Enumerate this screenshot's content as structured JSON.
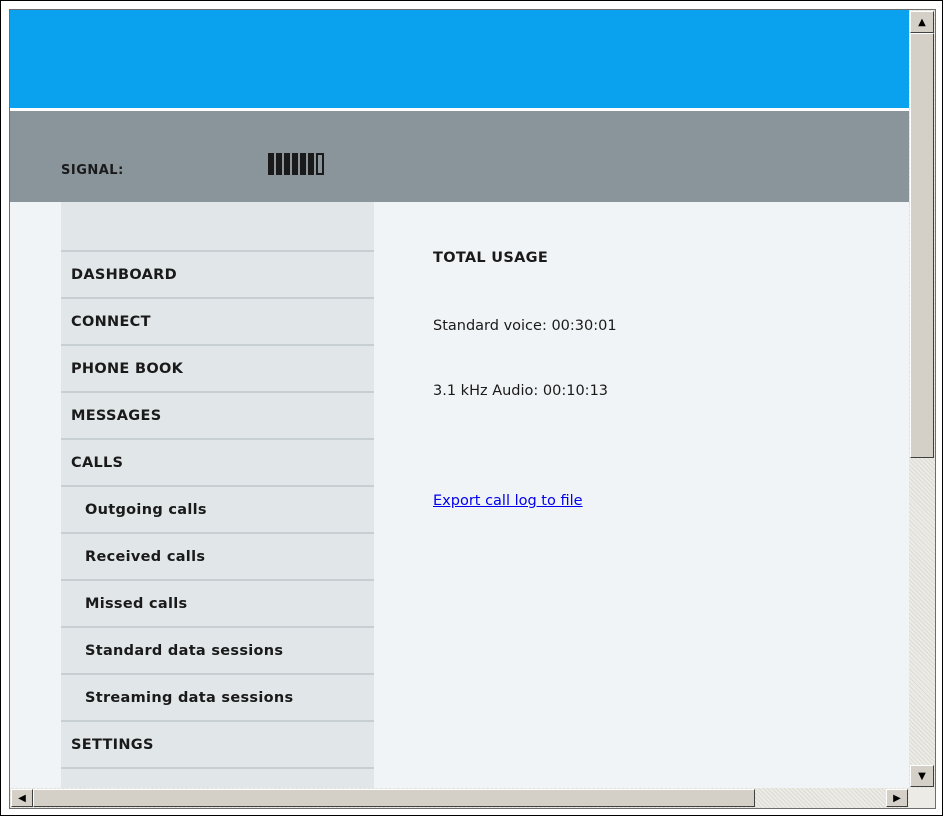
{
  "header": {
    "signal_label": "SIGNAL:",
    "signal_bars_filled": 6,
    "signal_bars_total": 7
  },
  "nav": {
    "items": [
      {
        "label": "DASHBOARD"
      },
      {
        "label": "CONNECT"
      },
      {
        "label": "PHONE BOOK"
      },
      {
        "label": "MESSAGES"
      },
      {
        "label": "CALLS"
      },
      {
        "label": "Outgoing calls"
      },
      {
        "label": "Received calls"
      },
      {
        "label": "Missed calls"
      },
      {
        "label": "Standard data sessions"
      },
      {
        "label": "Streaming data sessions"
      },
      {
        "label": "SETTINGS"
      }
    ]
  },
  "main": {
    "title": "TOTAL USAGE",
    "standard_voice": "Standard voice: 00:30:01",
    "audio": "3.1 kHz Audio: 00:10:13",
    "export_link": "Export call log to file"
  },
  "colors": {
    "header_blue": "#0aa2ee",
    "signal_bar_bg": "#89959b",
    "nav_bg": "#e1e6e8",
    "content_bg": "#f1f4f6",
    "link": "#0000ee"
  },
  "icons": {
    "scroll_up": "▲",
    "scroll_down": "▼",
    "scroll_left": "◀",
    "scroll_right": "▶"
  }
}
